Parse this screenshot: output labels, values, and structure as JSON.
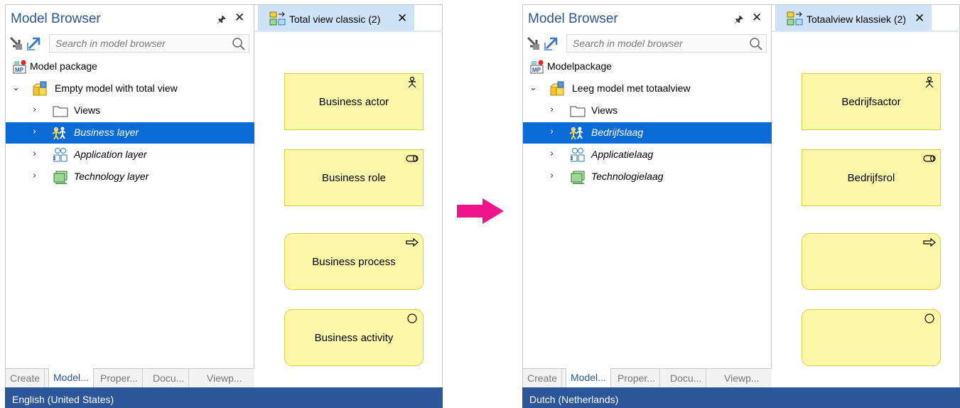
{
  "screens": [
    {
      "model_browser": {
        "title": "Model Browser",
        "search_placeholder": "Search in model browser",
        "tree": [
          {
            "label": "Model package",
            "icon": "model-package-icon",
            "expanded": null
          },
          {
            "label": "Empty model with total view",
            "icon": "model-icon",
            "expanded": true
          },
          {
            "label": "Views",
            "icon": "folder-icon",
            "expanded": false
          },
          {
            "label": "Business layer",
            "icon": "business-layer-icon",
            "expanded": false,
            "selected": true
          },
          {
            "label": "Application layer",
            "icon": "application-layer-icon",
            "expanded": false
          },
          {
            "label": "Technology layer",
            "icon": "technology-layer-icon",
            "expanded": false
          }
        ],
        "tabs": [
          "Create",
          "Model...",
          "Proper...",
          "Docu...",
          "Viewp..."
        ],
        "active_tab": "Model..."
      },
      "document_tab": {
        "title": "Total view classic (2)"
      },
      "elements": [
        {
          "label": "Business actor",
          "kind": "actor-icon"
        },
        {
          "label": "Business role",
          "kind": "role-icon"
        },
        {
          "label": "Business process",
          "kind": "process-icon"
        },
        {
          "label": "Business activity",
          "kind": "activity-icon"
        }
      ],
      "status": "English (United States)"
    },
    {
      "model_browser": {
        "title": "Model Browser",
        "search_placeholder": "Search in model browser",
        "tree": [
          {
            "label": "Modelpackage",
            "icon": "model-package-icon",
            "expanded": null
          },
          {
            "label": "Leeg model met totaalview",
            "icon": "model-icon",
            "expanded": true
          },
          {
            "label": "Views",
            "icon": "folder-icon",
            "expanded": false
          },
          {
            "label": "Bedrijfslaag",
            "icon": "business-layer-icon",
            "expanded": false,
            "selected": true
          },
          {
            "label": "Applicatielaag",
            "icon": "application-layer-icon",
            "expanded": false
          },
          {
            "label": "Technologielaag",
            "icon": "technology-layer-icon",
            "expanded": false
          }
        ],
        "tabs": [
          "Create",
          "Model...",
          "Proper...",
          "Docu...",
          "Viewp..."
        ],
        "active_tab": "Model..."
      },
      "document_tab": {
        "title": "Totaalview klassiek (2)"
      },
      "elements": [
        {
          "label": "Bedrijfsactor",
          "kind": "actor-icon"
        },
        {
          "label": "Bedrijfsrol",
          "kind": "role-icon"
        },
        {
          "label": "",
          "kind": "process-icon"
        },
        {
          "label": "",
          "kind": "activity-icon"
        }
      ],
      "status": "Dutch (Netherlands)"
    }
  ],
  "colors": {
    "title_blue": "#2b579a",
    "selection_blue": "#0a6ad6",
    "status_bar": "#2b579a",
    "element_fill": "#fdf8a7",
    "element_border": "#d9cf3f",
    "arrow_magenta": "#f0148c",
    "doc_tab_bg": "#cfe3f7"
  },
  "glyphs": {
    "pin": "📌",
    "close": "✕",
    "chevron_right": "›",
    "chevron_down": "⌄"
  }
}
